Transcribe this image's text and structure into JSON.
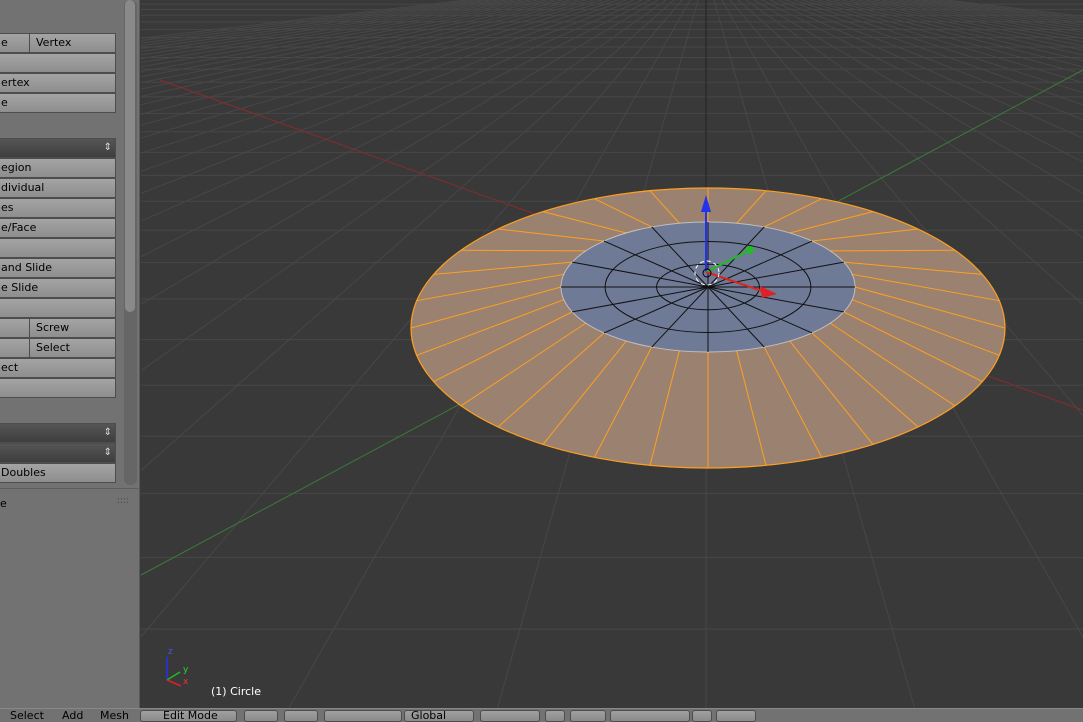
{
  "panel": {
    "rows": [
      "e",
      "",
      "ertex",
      "e",
      "",
      "egion",
      "dividual",
      "es",
      "e/Face",
      "",
      "and Slide",
      "e Slide",
      "",
      "",
      "",
      "ect",
      "",
      "",
      "",
      "Doubles"
    ],
    "row0_right": "Vertex",
    "screw": "Screw",
    "select": "Select",
    "subpanel_title": "e",
    "grip": "::::"
  },
  "viewport": {
    "object_label": "(1) Circle",
    "axis": {
      "x": "x",
      "y": "y",
      "z": "z"
    },
    "colors": {
      "background": "#393939",
      "selected_face": "#9a8170",
      "edge_selected": "#ffa020",
      "inner_face": "#6f7a96",
      "x_axis": "#cc3333",
      "y_axis": "#339933"
    }
  },
  "header": {
    "menus": [
      "Select",
      "Add",
      "Mesh"
    ],
    "mode": "Edit Mode",
    "orientation": "Global"
  }
}
